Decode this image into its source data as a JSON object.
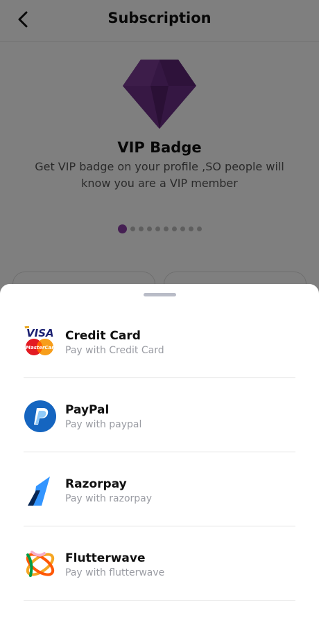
{
  "header": {
    "title": "Subscription"
  },
  "feature": {
    "title": "VIP Badge",
    "description": "Get VIP badge on your profile ,SO people will know you are a VIP member"
  },
  "carousel": {
    "count": 10,
    "active_index": 0
  },
  "payment_sheet": {
    "methods": [
      {
        "name": "Credit Card",
        "subtitle": "Pay with Credit Card",
        "icon": "credit-card-visa-mastercard-icon"
      },
      {
        "name": "PayPal",
        "subtitle": "Pay with paypal",
        "icon": "paypal-icon"
      },
      {
        "name": "Razorpay",
        "subtitle": "Pay with razorpay",
        "icon": "razorpay-icon"
      },
      {
        "name": "Flutterwave",
        "subtitle": "Pay with flutterwave",
        "icon": "flutterwave-icon"
      }
    ]
  },
  "colors": {
    "diamond": "#6b2f86",
    "active_dot": "#8a3fa6",
    "overlay": "rgba(0,0,0,0.5)"
  }
}
